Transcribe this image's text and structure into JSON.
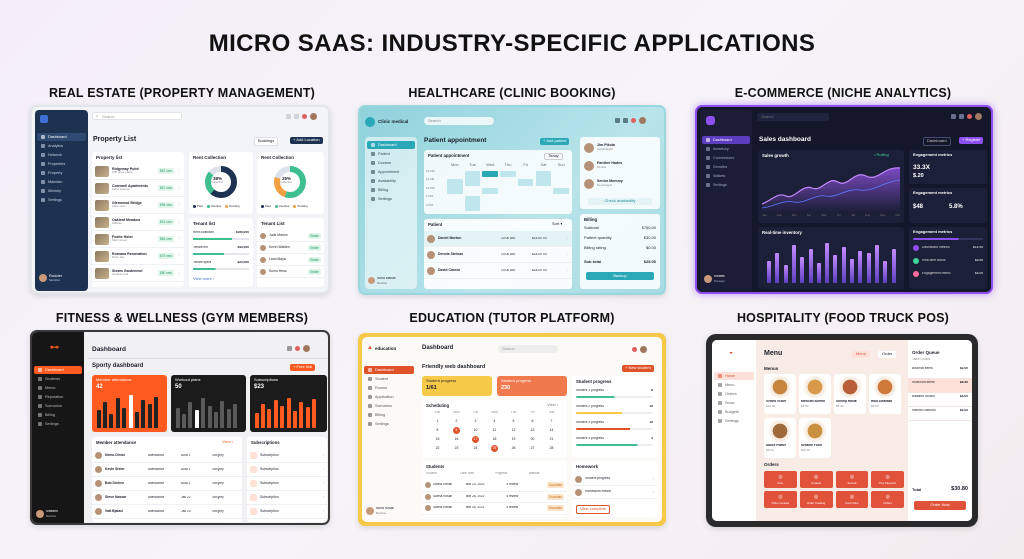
{
  "page_title": "MICRO SAAS: INDUSTRY-SPECIFIC APPLICATIONS",
  "sections": {
    "realestate": "REAL ESTATE (PROPERTY MANAGEMENT)",
    "healthcare": "HEALTHCARE (CLINIC BOOKING)",
    "ecommerce": "E-COMMERCE (NICHE ANALYTICS)",
    "fitness": "FITNESS & WELLNESS (GYM MEMBERS)",
    "education": "EDUCATION (TUTOR PLATFORM)",
    "hospitality": "HOSPITALITY (FOOD TRUCK POS)"
  },
  "re": {
    "search": "Search",
    "nav": [
      "Dashboard",
      "Analytics",
      "Network",
      "Properties",
      "Property",
      "Maintain",
      "Ministry",
      "Settings"
    ],
    "page": "Property List",
    "buildings_btn": "Buildings",
    "add_btn": "+ Add Location",
    "list_title": "Property list",
    "props": [
      {
        "name": "Ridgeway Point",
        "sub": "Cliff drive place",
        "tag": "$52 new"
      },
      {
        "name": "Cornwell Apartments",
        "sub": "Alder avenue",
        "tag": "$67 new"
      },
      {
        "name": "Glenwood Bridge",
        "sub": "Lake view",
        "tag": "$95 new"
      },
      {
        "name": "Oakleaf Meadow",
        "sub": "Hillside",
        "tag": "$41 new"
      },
      {
        "name": "Foxite Hotel",
        "sub": "Main street",
        "tag": "$65 new"
      },
      {
        "name": "Romana Renovation",
        "sub": "River bay",
        "tag": "$75 new"
      },
      {
        "name": "Steam Gardenmel",
        "sub": "Central park",
        "tag": "$80 new"
      }
    ],
    "rent1": "Rent Collection",
    "rent1_pct": "38%",
    "rent1_sub": "Collection",
    "rent2": "Rent Collection",
    "rent2_pct": "25%",
    "rent2_sub": "Collection",
    "legend": [
      "Paid",
      "Overdue",
      "Pending"
    ],
    "tenant1": "Tenant list",
    "tenant_rows": [
      {
        "label": "Rent collection",
        "val": "$190,000"
      },
      {
        "label": "Tenant left",
        "val": "$40,000"
      },
      {
        "label": "Tenant spent",
        "val": "$20,000"
      }
    ],
    "view_more": "View more ›",
    "tenant2": "Tenant List",
    "tenants": [
      {
        "name": "Jude Marion",
        "tag": "Stable"
      },
      {
        "name": "Kevin Walden",
        "tag": "Stable"
      },
      {
        "name": "Land Maya",
        "tag": "Stable"
      },
      {
        "name": "Sumo Hess",
        "tag": "Stable"
      }
    ],
    "user": "Rodder",
    "user_sub": "Member"
  },
  "hc": {
    "brand": "Clinic medical",
    "search": "Search",
    "nav": [
      "Dashboard",
      "Patient",
      "Doctors",
      "Appointment",
      "Availability",
      "Billing",
      "Settings"
    ],
    "page": "Patient appointment",
    "add_btn": "+ Add patient",
    "cal_title": "Patient appointment",
    "today": "Today",
    "days": [
      "Mon",
      "Tue",
      "Wed",
      "Thu",
      "Fri",
      "Sat",
      "Sun"
    ],
    "times": [
      "10 AM",
      "11 AM",
      "12 PM",
      "1 PM",
      "2 PM"
    ],
    "doctors": [
      {
        "name": "Jim Pikola",
        "sub": "Cardiologist"
      },
      {
        "name": "Panther Hades",
        "sub": "Dentist"
      },
      {
        "name": "Senior Mommy",
        "sub": "Neurologist"
      }
    ],
    "check_btn": "Check availability",
    "patient_title": "Patient",
    "sort": "Sort ▾",
    "patients": [
      {
        "name": "Daniel Morton",
        "time": "10:00 AM",
        "amt": "$15.00 00"
      },
      {
        "name": "Dennis Steinas",
        "time": "10:00 AM",
        "amt": "$18.00 00"
      },
      {
        "name": "David Cassio",
        "time": "10:00 AM",
        "amt": "$18.00 00"
      }
    ],
    "billing_title": "Billing",
    "billing": [
      {
        "k": "Subtotal",
        "v": "$750.00"
      },
      {
        "k": "Patient quantity",
        "v": "$30.00"
      },
      {
        "k": "Billing rating",
        "v": "$0.00"
      }
    ],
    "total_k": "Sub total",
    "total_v": "$25.00",
    "pay_btn": "Backup",
    "user": "Nona Manas",
    "user_sub": "Member"
  },
  "ec": {
    "search": "Search",
    "nav": [
      "Dashboard",
      "Inventory",
      "Conversions",
      "Growths",
      "Wallets",
      "Settings"
    ],
    "page": "Sales dashboard",
    "dash_btn": "Dashboard",
    "reg_btn": "+ Register",
    "growth_title": "Sales growth",
    "growth_tag": "• Rolling",
    "months": [
      "Jan",
      "Feb",
      "Mar",
      "Apr",
      "May",
      "Jun",
      "Jul",
      "Aug",
      "Sep",
      "Oct"
    ],
    "eng1": "Engagement metrics",
    "eng1_a": "33.3X",
    "eng1_b": "$.20",
    "eng2": "Engagement metrics",
    "eng2_a": "$48",
    "eng2_b": "5.8%",
    "inv_title": "Real-time inventory",
    "eng3": "Engagement metrics",
    "eng3_rows": [
      {
        "k": "Dashboard metrics",
        "v": "$14.95"
      },
      {
        "k": "Real-time works",
        "v": "$5.95"
      },
      {
        "k": "Engagement metric",
        "v": "$4.05"
      }
    ],
    "user": "Rowles",
    "user_sub": "Manager"
  },
  "fit": {
    "page": "Dashboard",
    "title": "Sporty dashboard",
    "btn": "+ Free trial",
    "card1": "Member attendance",
    "card1_v": "42",
    "card2": "Workout plans",
    "card2_v": "50",
    "card3": "Subscriptions",
    "card3_v": "$23",
    "nav": [
      "Dashboard",
      "Students",
      "Memo",
      "Reputation",
      "Scenarios",
      "Billing",
      "Settings"
    ],
    "att_title": "Member attendance",
    "view": "View ›",
    "members": [
      {
        "name": "Nemo Dinist",
        "a": "Attendance",
        "c": "Aura 1",
        "d": "3rd grey"
      },
      {
        "name": "Kevin Steier",
        "a": "Attendance",
        "c": "Aura 1",
        "d": "3rd grey"
      },
      {
        "name": "Bob Dinhen",
        "a": "Attendance",
        "c": "Aura 2",
        "d": "3rd grey"
      },
      {
        "name": "Steve Nassar",
        "a": "Attendance",
        "c": "Jan 22",
        "d": "3rd grey"
      },
      {
        "name": "Vatt Bjalaci",
        "a": "Attendance",
        "c": "Jan 23",
        "d": "3rd grey"
      }
    ],
    "sub_title": "Subscriptions",
    "subs": [
      "Subscription",
      "Subscription",
      "Subscription",
      "Subscription",
      "Subscription"
    ],
    "user": "Sweden",
    "user_sub": "Member"
  },
  "edu": {
    "brand": "education",
    "page": "Dashboard",
    "search": "Search",
    "nav": [
      "Dashboard",
      "Student",
      "Rooms",
      "Application",
      "Scenarios",
      "Billing",
      "Settings"
    ],
    "title": "Friendly web dashboard",
    "new_btn": "+ New student",
    "prog1": "Student progress",
    "prog1_v": "1/61",
    "prog2": "Student progress",
    "prog2_v": "230",
    "sched": "Scheduling",
    "view": "View ›",
    "wd": [
      "Sun",
      "Mon",
      "Tue",
      "Wed",
      "Thu",
      "Fri",
      "Sat"
    ],
    "dates": [
      "1",
      "2",
      "3",
      "4",
      "5",
      "6",
      "7",
      "8",
      "9",
      "10",
      "11",
      "12",
      "13",
      "14",
      "15",
      "16",
      "17",
      "18",
      "19",
      "20",
      "21",
      "22",
      "23",
      "24",
      "25",
      "26",
      "27",
      "28"
    ],
    "sp_title": "Student progress",
    "sp": [
      {
        "k": "Student 1 progress",
        "v": "8"
      },
      {
        "k": "Student 2 progress",
        "v": "10"
      },
      {
        "k": "Student 3 progress",
        "v": "15"
      },
      {
        "k": "Student 4 progress",
        "v": "4"
      }
    ],
    "st_title": "Students",
    "st_head": [
      "Student",
      "Date note",
      "Progress",
      "Attitude"
    ],
    "students": [
      {
        "name": "Sanna Rosan",
        "date": "Mar 23, 2022",
        "p": "4 review",
        "tag": "Guardian"
      },
      {
        "name": "Sanna Rosan",
        "date": "Mar 28, 2022",
        "p": "4 review",
        "tag": "Guardian"
      },
      {
        "name": "Sanna Rosan",
        "date": "Mar 16, 2021",
        "p": "4 review",
        "tag": "Guardian"
      }
    ],
    "hw_title": "Homework",
    "hw": [
      "Student progress",
      "Homework media"
    ],
    "hw_btn": "View complete",
    "user": "Nona Rosan",
    "user_sub": "Member"
  },
  "hos": {
    "title": "Menu",
    "menu_btn": "Menu",
    "order_btn": "Order",
    "nav": [
      "Home",
      "Menu",
      "Orders",
      "Stock",
      "Budgets",
      "Settings"
    ],
    "menus_title": "Menus",
    "dishes": [
      {
        "name": "Grilled Griller",
        "p": "$12.00"
      },
      {
        "name": "Mexican Burrito",
        "p": "$5.50"
      },
      {
        "name": "Shrimp Rasta",
        "p": "$8.00"
      },
      {
        "name": "Hola Amantas",
        "p": "$9.00"
      },
      {
        "name": "Sauce Platter",
        "p": "$4.00"
      },
      {
        "name": "Sesame Food",
        "p": "$11.00"
      }
    ],
    "orders_title": "Orders",
    "order_btns": [
      "Dine",
      "Cooked",
      "Served",
      "Pay Payment",
      "Order Cooked",
      "Order Cooking",
      "Cool Order",
      "Orders"
    ],
    "queue_title": "Order Queue",
    "table_lbl": "Table Orders",
    "queue": [
      {
        "k": "Biscmat Items",
        "v": "$2.00"
      },
      {
        "k": "Roast kid ltems",
        "v": "$8.50"
      },
      {
        "k": "Balsamt Stocks",
        "v": "$4.00"
      },
      {
        "k": "Hamari Dietrons",
        "v": "$2.00"
      }
    ],
    "total_k": "Total",
    "total_v": "$30.80",
    "confirm_btn": "Order Now"
  }
}
